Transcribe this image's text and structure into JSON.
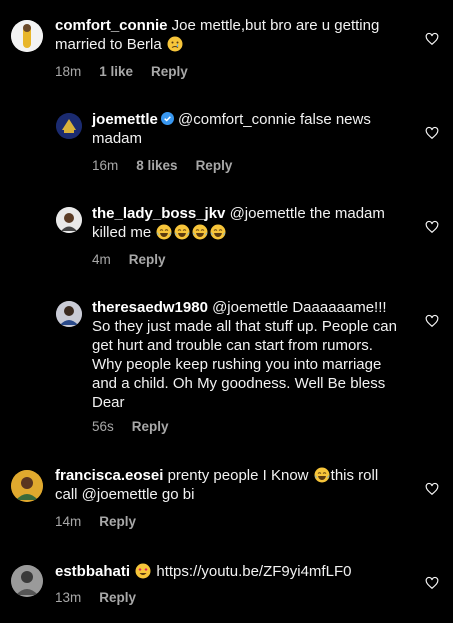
{
  "comments": [
    {
      "username": "comfort_connie",
      "text": " Joe mettle,but bro are u getting married to Berla",
      "emoji": "crying-face",
      "time": "18m",
      "likes": "1 like",
      "reply": "Reply"
    },
    {
      "username": "joemettle",
      "verified": true,
      "text": " @comfort_connie false news madam",
      "time": "16m",
      "likes": "8 likes",
      "reply": "Reply"
    },
    {
      "username": "the_lady_boss_jkv",
      "text": " @joemettle the madam killed me",
      "emoji": "tears-of-joy x4",
      "time": "4m",
      "reply": "Reply"
    },
    {
      "username": "theresaedw1980",
      "text": " @joemettle Daaaaaame!!! So they just made all that stuff up. People can get hurt and trouble can start from rumors. Why people keep rushing you into marriage and a child. Oh My goodness. Well Be bless Dear",
      "time": "56s",
      "reply": "Reply"
    },
    {
      "username": "francisca.eosei",
      "text_a": " prenty people I Know ",
      "emoji": "tears-of-joy",
      "text_b": "this roll call @joemettle go bi",
      "time": "14m",
      "reply": "Reply"
    },
    {
      "username": "estbbahati",
      "emoji": "heart-eyes",
      "text": " https://youtu.be/ZF9yi4mfLF0",
      "time": "13m",
      "reply": "Reply"
    }
  ],
  "colors": {
    "background": "#000000",
    "meta": "#a8a8a8",
    "verified": "#3897f0"
  },
  "icons": [
    "heart-outline-icon",
    "verified-badge-icon"
  ]
}
